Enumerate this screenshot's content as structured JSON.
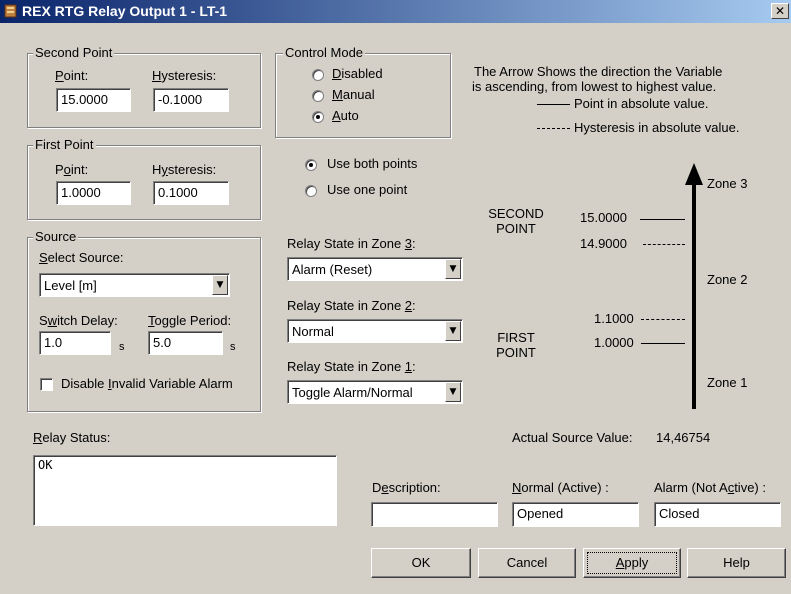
{
  "window": {
    "title": "REX RTG Relay Output 1 - LT-1",
    "close_glyph": "✕"
  },
  "second_point": {
    "legend": "Second Point",
    "point_label_pre": "",
    "point_label_u": "P",
    "point_label_post": "oint:",
    "hyst_label_pre": "",
    "hyst_label_u": "H",
    "hyst_label_post": "ysteresis:",
    "point_value": "15.0000",
    "hyst_value": "-0.1000"
  },
  "first_point": {
    "legend": "First Point",
    "point_label_pre": "P",
    "point_label_u": "o",
    "point_label_post": "int:",
    "hyst_label_pre": "H",
    "hyst_label_u": "y",
    "hyst_label_post": "steresis:",
    "point_value": "1.0000",
    "hyst_value": "0.1000"
  },
  "source": {
    "legend": "Source",
    "select_label_u": "S",
    "select_label_post": "elect Source:",
    "select_value": "Level [m]",
    "switch_label_pre": "S",
    "switch_label_u": "w",
    "switch_label_post": "itch Delay:",
    "toggle_label_u": "T",
    "toggle_label_post": "oggle Period:",
    "switch_value": "1.0",
    "toggle_value": "5.0",
    "unit": "s",
    "disable_label_pre": "Disable ",
    "disable_label_u": "I",
    "disable_label_post": "nvalid Variable Alarm",
    "disable_checked": false
  },
  "control_mode": {
    "legend": "Control Mode",
    "options": [
      {
        "u": "D",
        "rest": "isabled",
        "selected": false
      },
      {
        "u": "M",
        "rest": "anual",
        "selected": false
      },
      {
        "u": "A",
        "rest": "uto",
        "selected": true
      }
    ]
  },
  "points_mode": {
    "options": [
      {
        "label": "Use both points",
        "selected": true
      },
      {
        "label": "Use one point",
        "selected": false
      }
    ]
  },
  "relay_zones": [
    {
      "label_pre": "Relay State in Zone ",
      "label_u": "3",
      "label_post": ":",
      "value": "Alarm (Reset)"
    },
    {
      "label_pre": "Relay State in Zone ",
      "label_u": "2",
      "label_post": ":",
      "value": "Normal"
    },
    {
      "label_pre": "Relay State in Zone ",
      "label_u": "1",
      "label_post": ":",
      "value": "Toggle Alarm/Normal"
    }
  ],
  "diagram": {
    "note_line1": "The Arrow Shows the direction the Variable",
    "note_line2": "is ascending, from lowest to highest value.",
    "legend_solid": "Point in absolute value.",
    "legend_dashed": "Hysteresis in absolute value.",
    "zone3": "Zone 3",
    "zone2": "Zone 2",
    "zone1": "Zone 1",
    "second_point_line1": "SECOND",
    "second_point_line2": "POINT",
    "first_point_line1": "FIRST",
    "first_point_line2": "POINT",
    "second_value": "15.0000",
    "second_hyst_value": "14.9000",
    "first_hyst_value": "1.1000",
    "first_value": "1.0000"
  },
  "relay_status": {
    "label_u": "R",
    "label_post": "elay Status:",
    "value": "OK"
  },
  "actual_source": {
    "label": "Actual Source Value:",
    "value": "14,46754"
  },
  "outputs": {
    "desc_label_pre": "D",
    "desc_label_u": "e",
    "desc_label_post": "scription:",
    "normal_label_u": "N",
    "normal_label_post": "ormal (Active) :",
    "alarm_label_pre": "Alarm (Not A",
    "alarm_label_u": "c",
    "alarm_label_post": "tive) :",
    "desc_value": "",
    "normal_value": "Opened",
    "alarm_value": "Closed"
  },
  "buttons": {
    "ok": "OK",
    "cancel": "Cancel",
    "apply_u": "A",
    "apply_post": "pply",
    "help": "Help"
  },
  "colors": {
    "titlebar_start": "#0a246a",
    "titlebar_end": "#a6caf0",
    "dialog_bg": "#d4d0c8"
  }
}
